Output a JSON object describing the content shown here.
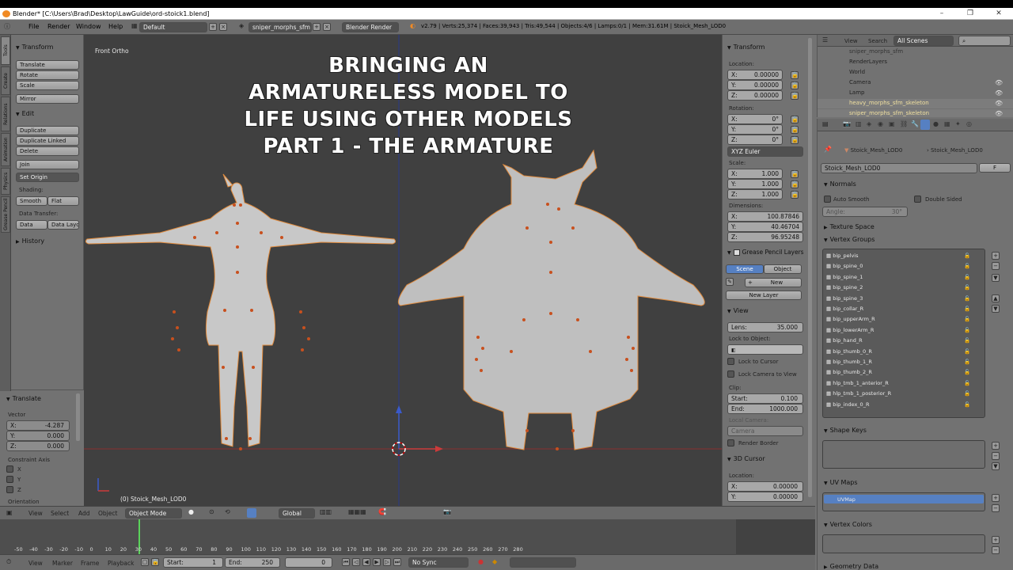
{
  "window": {
    "title": "Blender* [C:\\Users\\Brad\\Desktop\\LawGuide\\ord-stoick1.blend]",
    "controls": [
      "–",
      "❐",
      "✕"
    ]
  },
  "menubar": {
    "menus": [
      "File",
      "Render",
      "Window",
      "Help"
    ],
    "layout": "Default",
    "scene": "sniper_morphs_sfm",
    "engine": "Blender Render",
    "stats": "v2.79 | Verts:25,374 | Faces:39,943 | Tris:49,544 | Objects:4/6 | Lamps:0/1 | Mem:31.61M | Stoick_Mesh_LOD0"
  },
  "toolshelf": {
    "tabs": [
      "Tools",
      "Create",
      "Relations",
      "Animation",
      "Physics",
      "Grease Pencil"
    ],
    "transform_header": "Transform",
    "transform_buttons": [
      "Translate",
      "Rotate",
      "Scale"
    ],
    "mirror": "Mirror",
    "edit_header": "Edit",
    "edit_buttons": [
      "Duplicate",
      "Duplicate Linked",
      "Delete"
    ],
    "join": "Join",
    "set_origin": "Set Origin",
    "shading_label": "Shading:",
    "smooth": "Smooth",
    "flat": "Flat",
    "data_transfer_label": "Data Transfer:",
    "data": "Data",
    "data_layout": "Data Layo",
    "history_header": "History"
  },
  "operator": {
    "header": "Translate",
    "vector_label": "Vector",
    "x": "X:",
    "x_val": "-4.287",
    "y": "Y:",
    "y_val": "0.000",
    "z": "Z:",
    "z_val": "0.000",
    "constraint_label": "Constraint Axis",
    "axes": [
      "X",
      "Y",
      "Z"
    ],
    "orientation_label": "Orientation"
  },
  "viewport": {
    "view_name": "Front Ortho",
    "object_label": "(0) Stoick_Mesh_LOD0",
    "overlay_lines": [
      "BRINGING AN",
      "ARMATURELESS MODEL TO",
      "LIFE USING OTHER MODELS",
      "PART 1 - THE ARMATURE"
    ],
    "colors": {
      "bg": "#404040",
      "mesh": "#c8c8c8",
      "outline": "#e08a3c",
      "bone_dot": "#c8501e"
    }
  },
  "npanel": {
    "transform_header": "Transform",
    "location_label": "Location:",
    "location": [
      "0.00000",
      "0.00000",
      "0.00000"
    ],
    "rotation_label": "Rotation:",
    "rotation": [
      "0°",
      "0°",
      "0°"
    ],
    "rotation_mode": "XYZ Euler",
    "scale_label": "Scale:",
    "scale": [
      "1.000",
      "1.000",
      "1.000"
    ],
    "dimensions_label": "Dimensions:",
    "dimensions": [
      "100.87846",
      "40.46704",
      "96.95248"
    ],
    "axis_labels": [
      "X:",
      "Y:",
      "Z:"
    ],
    "grease_header": "Grease Pencil Layers",
    "scene_tab": "Scene",
    "object_tab": "Object",
    "new_btn": "New",
    "new_layer_btn": "New Layer",
    "view_header": "View",
    "lens_label": "Lens:",
    "lens_val": "35.000",
    "lock_label": "Lock to Object:",
    "lock_cursor": "Lock to Cursor",
    "lock_camera": "Lock Camera to View",
    "clip_label": "Clip:",
    "start_label": "Start:",
    "start_val": "0.100",
    "end_label": "End:",
    "end_val": "1000.000",
    "local_camera_label": "Local Camera:",
    "camera_field": "Camera",
    "render_border": "Render Border",
    "cursor_header": "3D Cursor",
    "cursor_location_label": "Location:",
    "cursor_x": "0.00000",
    "cursor_y": "0.00000"
  },
  "outliner": {
    "view": "View",
    "search": "Search",
    "scenes": "All Scenes",
    "rows": [
      "sniper_morphs_sfm",
      "RenderLayers",
      "World",
      "Camera",
      "Lamp",
      "heavy_morphs_sfm_skeleton",
      "sniper_morphs_sfm_skeleton"
    ]
  },
  "properties": {
    "breadcrumb_a": "Stoick_Mesh_LOD0",
    "breadcrumb_b": "Stoick_Mesh_LOD0",
    "mesh_name": "Stoick_Mesh_LOD0",
    "fake_user": "F",
    "normals_header": "Normals",
    "auto_smooth": "Auto Smooth",
    "double_sided": "Double Sided",
    "angle": "Angle:",
    "angle_val": "30°",
    "texture_space": "Texture Space",
    "vertex_groups_header": "Vertex Groups",
    "vertex_groups": [
      "bip_pelvis",
      "bip_spine_0",
      "bip_spine_1",
      "bip_spine_2",
      "bip_spine_3",
      "bip_collar_R",
      "bip_upperArm_R",
      "bip_lowerArm_R",
      "bip_hand_R",
      "bip_thumb_0_R",
      "bip_thumb_1_R",
      "bip_thumb_2_R",
      "hlp_tmb_1_anterior_R",
      "hlp_tmb_1_posterior_R",
      "bip_index_0_R"
    ],
    "shape_keys_header": "Shape Keys",
    "uv_maps_header": "UV Maps",
    "uv_map": "UVMap",
    "vertex_colors_header": "Vertex Colors",
    "geometry_data_header": "Geometry Data"
  },
  "header3d": {
    "view": "View",
    "select": "Select",
    "add": "Add",
    "object": "Object",
    "mode": "Object Mode",
    "orientation": "Global"
  },
  "timeline": {
    "ticks": [
      "-50",
      "-40",
      "-30",
      "-20",
      "-10",
      "0",
      "10",
      "20",
      "30",
      "40",
      "50",
      "60",
      "70",
      "80",
      "90",
      "100",
      "110",
      "120",
      "130",
      "140",
      "150",
      "160",
      "170",
      "180",
      "190",
      "200",
      "210",
      "220",
      "230",
      "240",
      "250",
      "260",
      "270",
      "280"
    ],
    "view": "View",
    "marker": "Marker",
    "frame": "Frame",
    "playback": "Playback",
    "start_label": "Start:",
    "start_val": "1",
    "end_label": "End:",
    "end_val": "250",
    "current": "0",
    "sync": "No Sync"
  }
}
